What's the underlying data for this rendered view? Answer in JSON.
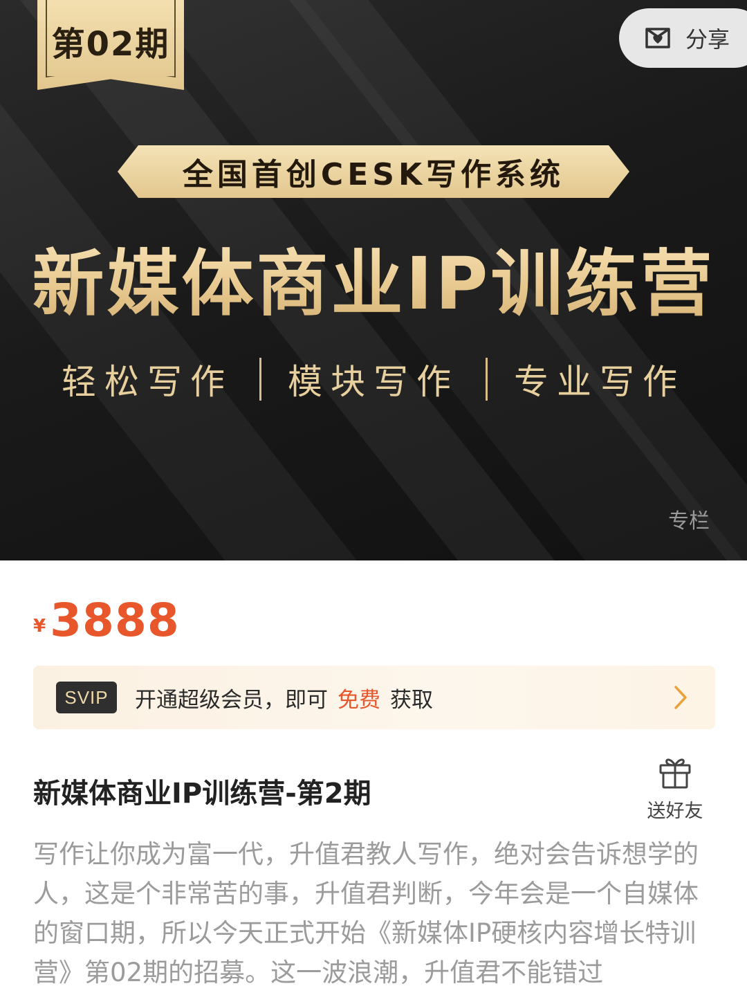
{
  "banner": {
    "issue_label": "第02期",
    "share_label": "分享",
    "tagline": "全国首创CESK写作系统",
    "main_title": "新媒体商业IP训练营",
    "features": [
      "轻松写作",
      "模块写作",
      "专业写作"
    ],
    "column_tag": "专栏"
  },
  "price": {
    "symbol": "¥",
    "amount": "3888",
    "color": "#e8572b"
  },
  "svip": {
    "badge": "SVIP",
    "text": "开通超级会员，即可",
    "free": "免费",
    "get": "获取"
  },
  "course": {
    "title": "新媒体商业IP训练营-第2期",
    "gift_label": "送好友",
    "description": "写作让你成为富一代，升值君教人写作，绝对会告诉想学的人，这是个非常苦的事，升值君判断，今年会是一个自媒体的窗口期，所以今天正式开始《新媒体IP硬核内容增长特训营》第02期的招募。这一波浪潮，升值君不能错过"
  },
  "colors": {
    "gold": "#e7c88e",
    "banner_bg": "#1a1a1a"
  },
  "icons": [
    "share-icon",
    "chevron-right-icon",
    "gift-icon"
  ]
}
